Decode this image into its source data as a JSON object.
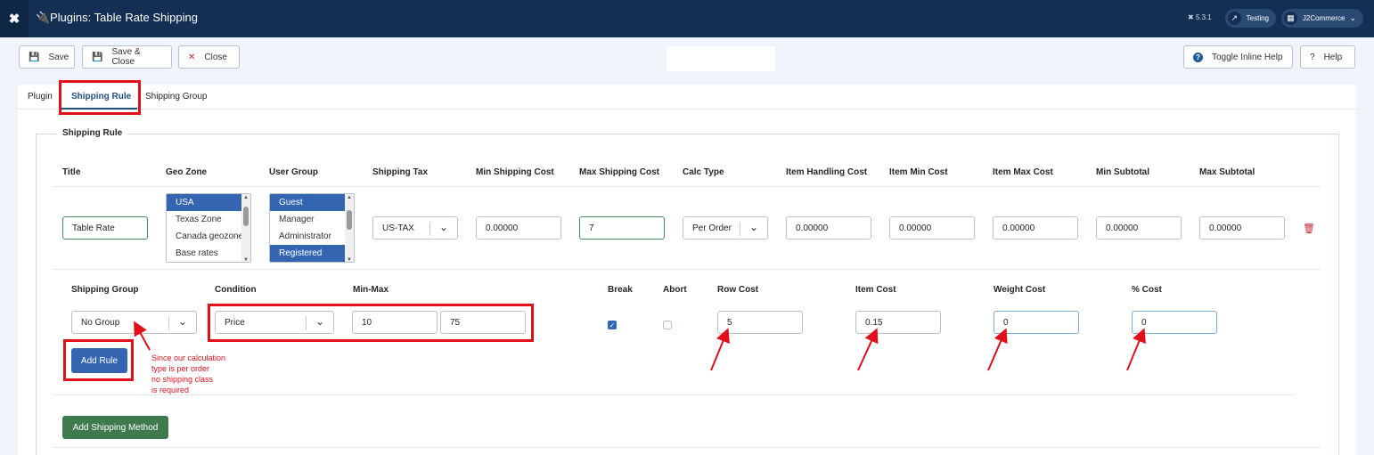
{
  "header": {
    "logo_glyph": "✖",
    "title": "Plugins: Table Rate Shipping",
    "version": "5.3.1",
    "site_pill": "Testing",
    "user_pill": "J2Commerce"
  },
  "toolbar": {
    "save": "Save",
    "save_close": "Save & Close",
    "close": "Close",
    "toggle_help": "Toggle Inline Help",
    "help": "Help"
  },
  "tabs": [
    "Plugin",
    "Shipping Rule",
    "Shipping Group"
  ],
  "fieldset_legend": "Shipping Rule",
  "rule_columns": [
    "Title",
    "Geo Zone",
    "User Group",
    "Shipping Tax",
    "Min Shipping Cost",
    "Max Shipping Cost",
    "Calc Type",
    "Item Handling Cost",
    "Item Min Cost",
    "Item Max Cost",
    "Min Subtotal",
    "Max Subtotal"
  ],
  "rule": {
    "title": "Table Rate",
    "geo_zones": [
      "USA",
      "Texas Zone",
      "Canada geozone",
      "Base rates"
    ],
    "geo_zone_selected": "USA",
    "user_groups": [
      "Guest",
      "Manager",
      "Administrator",
      "Registered"
    ],
    "user_groups_selected": [
      "Guest",
      "Registered"
    ],
    "shipping_tax": "US-TAX",
    "min_shipping_cost": "0.00000",
    "max_shipping_cost": "7",
    "calc_type": "Per Order",
    "item_handling_cost": "0.00000",
    "item_min_cost": "0.00000",
    "item_max_cost": "0.00000",
    "min_subtotal": "0.00000",
    "max_subtotal": "0.00000"
  },
  "sub_columns": [
    "Shipping Group",
    "Condition",
    "Min-Max",
    "Break",
    "Abort",
    "Row Cost",
    "Item Cost",
    "Weight Cost",
    "% Cost"
  ],
  "sub_rule": {
    "shipping_group": "No Group",
    "condition": "Price",
    "min": "10",
    "max": "75",
    "break_checked": true,
    "abort_checked": false,
    "row_cost": "5",
    "item_cost": "0.15",
    "weight_cost": "0",
    "percent_cost": "0"
  },
  "buttons": {
    "add_rule": "Add Rule",
    "add_shipping_method": "Add Shipping Method"
  },
  "annotation": [
    "Since our calculation",
    "type is per order",
    "no shipping class",
    "is required"
  ],
  "colors": {
    "header_bg": "#132f53",
    "primary": "#3465b0",
    "success": "#3f7a4e",
    "highlight": "#e0101a"
  }
}
